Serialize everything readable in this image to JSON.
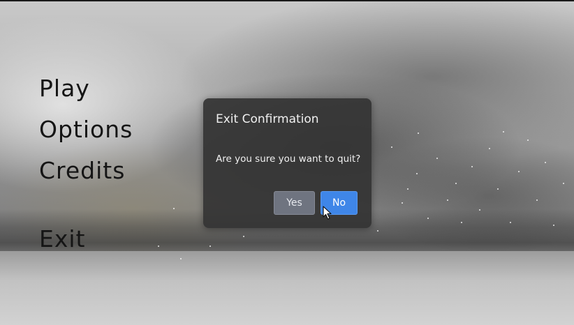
{
  "main_menu": {
    "items": [
      {
        "label": "Play"
      },
      {
        "label": "Options"
      },
      {
        "label": "Credits"
      },
      {
        "label": "Exit"
      }
    ]
  },
  "dialog": {
    "title": "Exit Confirmation",
    "message": "Are you sure you want to quit?",
    "yes_label": "Yes",
    "no_label": "No"
  },
  "colors": {
    "menu_text": "#151515",
    "dialog_bg": "#343434",
    "no_button": "#3f86e8",
    "yes_button": "#6f7480"
  },
  "icons": {
    "cursor": "mouse-pointer-icon"
  }
}
